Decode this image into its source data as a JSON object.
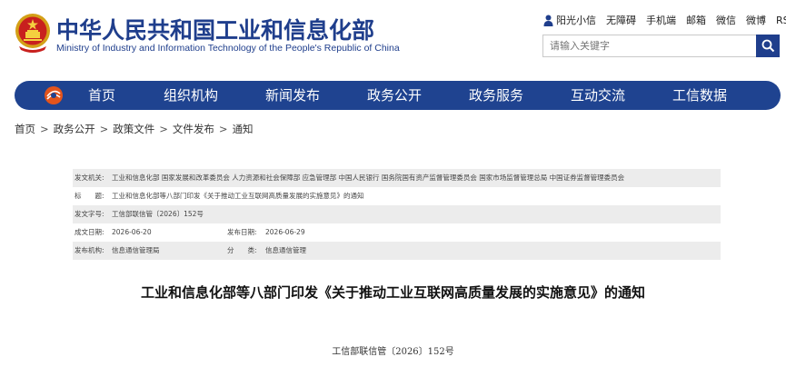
{
  "header": {
    "title_cn": "中华人民共和国工业和信息化部",
    "title_en": "Ministry of Industry and Information Technology of the People's Republic of China",
    "emblem_icon": "national-emblem-icon",
    "toplinks": [
      "阳光小信",
      "无障碍",
      "手机端",
      "邮箱",
      "微信",
      "微博",
      "RSS订阅"
    ],
    "search_placeholder": "请输入关键字",
    "brand_color": "#1f3e8c"
  },
  "nav": {
    "items": [
      "首页",
      "组织机构",
      "新闻发布",
      "政务公开",
      "政务服务",
      "互动交流",
      "工信数据"
    ],
    "color": "#1f4390"
  },
  "breadcrumb": [
    "首页",
    "政务公开",
    "政策文件",
    "文件发布",
    "通知"
  ],
  "meta": {
    "issuer_label": "发文机关:",
    "issuer_value": "工业和信息化部 国家发展和改革委员会 人力资源和社会保障部 应急管理部 中国人民银行 国务院国有资产监督管理委员会 国家市场监督管理总局 中国证券监督管理委员会",
    "title_label": "标　　题:",
    "title_value": "工业和信息化部等八部门印发《关于推动工业互联网高质量发展的实施意见》的通知",
    "docno_label": "发文字号:",
    "docno_value": "工信部联信管〔2026〕152号",
    "created_label": "成文日期:",
    "created_value": "2026-06-20",
    "published_label": "发布日期:",
    "published_value": "2026-06-29",
    "org_label": "发布机构:",
    "org_value": "信息通信管理局",
    "cat_label": "分　　类:",
    "cat_value": "信息通信管理"
  },
  "document": {
    "title": "工业和信息化部等八部门印发《关于推动工业互联网高质量发展的实施意见》的通知",
    "number": "工信部联信管〔2026〕152号"
  }
}
